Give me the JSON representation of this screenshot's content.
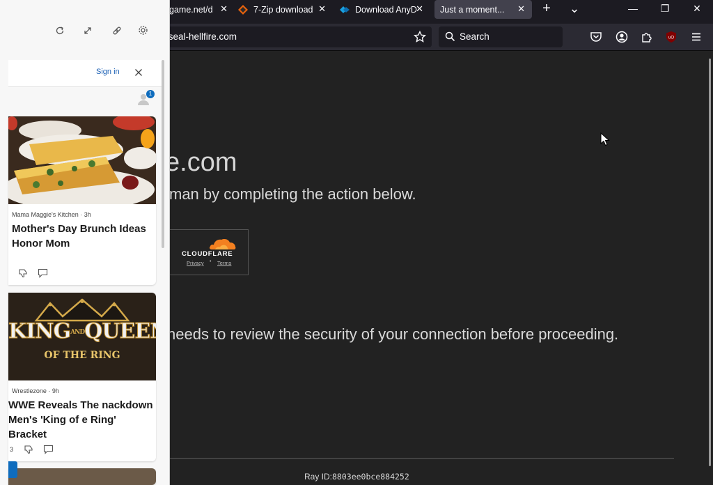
{
  "tabs": [
    {
      "label": "game.net/d",
      "close": "✕"
    },
    {
      "label": "7-Zip download",
      "close": "✕"
    },
    {
      "label": "Download AnyD",
      "close": "✕"
    },
    {
      "label": "Just a moment...",
      "close": "✕"
    }
  ],
  "tab_controls": {
    "new_tab": "+",
    "list_all": "⌄"
  },
  "window_controls": {
    "minimize": "—",
    "restore": "❐",
    "close": "✕"
  },
  "navbar": {
    "url": "/seal-hellfire.com",
    "search_placeholder": "Search"
  },
  "page": {
    "heading": "e.com",
    "subheading": "man by completing the action below.",
    "cloudflare": {
      "brand": "CLOUDFLARE",
      "privacy": "Privacy",
      "dot": "•",
      "terms": "Terms"
    },
    "security_text": "needs to review the security of your connection before proceeding.",
    "ray_label": "Ray ID:",
    "ray_id": "8803ee0bce884252"
  },
  "panel": {
    "sign_in": "Sign in",
    "notification_count": "1",
    "cards": [
      {
        "source": "Mama Maggie's Kitchen · 3h",
        "headline": "Mother's Day Brunch Ideas Honor Mom"
      },
      {
        "source": "Wrestlezone · 9h",
        "headline": "WWE Reveals The nackdown Men's 'King of e Ring' Bracket",
        "count": "3",
        "image_title_1": "KING",
        "image_title_and": "AND",
        "image_title_2": "QUEEN",
        "image_sub": "OF THE RING"
      }
    ]
  },
  "colors": {
    "page_bg": "#222222",
    "chrome": "#1c1b22",
    "navbar": "#2b2a33",
    "cloudflare": "#f38020"
  }
}
